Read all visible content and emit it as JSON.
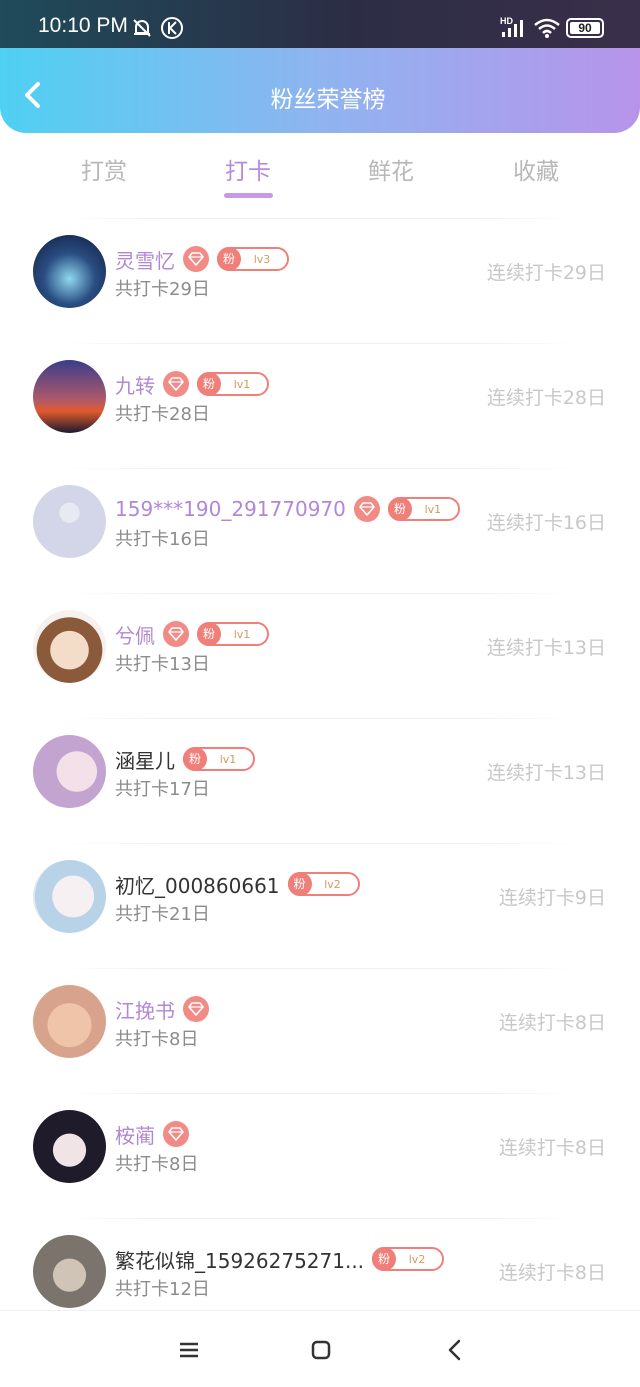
{
  "status": {
    "time": "10:10 PM",
    "battery": "90",
    "network": "HD"
  },
  "header": {
    "title": "粉丝荣誉榜"
  },
  "tabs": [
    {
      "label": "打赏",
      "active": false
    },
    {
      "label": "打卡",
      "active": true
    },
    {
      "label": "鲜花",
      "active": false
    },
    {
      "label": "收藏",
      "active": false
    }
  ],
  "badge": {
    "fen": "粉"
  },
  "rows": [
    {
      "name": "灵雪忆",
      "diamond": true,
      "level": "lv3",
      "total": "共打卡29日",
      "streak": "连续打卡29日",
      "vip": true
    },
    {
      "name": "九转",
      "diamond": true,
      "level": "lv1",
      "total": "共打卡28日",
      "streak": "连续打卡28日",
      "vip": true
    },
    {
      "name": "159***190_291770970",
      "diamond": true,
      "level": "lv1",
      "total": "共打卡16日",
      "streak": "连续打卡16日",
      "vip": true
    },
    {
      "name": "兮佩",
      "diamond": true,
      "level": "lv1",
      "total": "共打卡13日",
      "streak": "连续打卡13日",
      "vip": true
    },
    {
      "name": "涵星儿",
      "diamond": false,
      "level": "lv1",
      "total": "共打卡17日",
      "streak": "连续打卡13日",
      "vip": false
    },
    {
      "name": "初忆_000860661",
      "diamond": false,
      "level": "lv2",
      "total": "共打卡21日",
      "streak": "连续打卡9日",
      "vip": false
    },
    {
      "name": "江挽书",
      "diamond": true,
      "level": null,
      "total": "共打卡8日",
      "streak": "连续打卡8日",
      "vip": true
    },
    {
      "name": "桉蔺",
      "diamond": true,
      "level": null,
      "total": "共打卡8日",
      "streak": "连续打卡8日",
      "vip": true
    },
    {
      "name": "繁花似锦_15926275271...",
      "diamond": false,
      "level": "lv2",
      "total": "共打卡12日",
      "streak": "连续打卡8日",
      "vip": false
    }
  ],
  "colors": {
    "accent": "#b98ae0",
    "badge": "#f07f7a",
    "vip_name": "#b287d6"
  }
}
